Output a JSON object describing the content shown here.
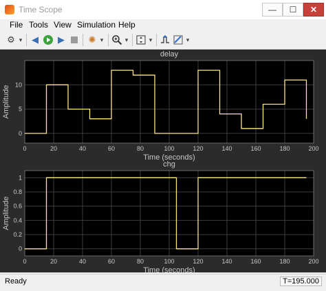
{
  "window": {
    "title": "Time Scope",
    "minimize_glyph": "—",
    "maximize_glyph": "☐",
    "close_glyph": "✕"
  },
  "menu": [
    "File",
    "Tools",
    "View",
    "Simulation",
    "Help"
  ],
  "toolbar": {
    "icons": [
      "gear-icon",
      "step-back-icon",
      "run-icon",
      "step-forward-icon",
      "stop-icon",
      "highlight-icon",
      "zoom-icon",
      "autoscale-icon",
      "triggers-icon",
      "cursor-measurement-icon"
    ]
  },
  "status": {
    "text": "Ready",
    "time": "T=195.000"
  },
  "colors": {
    "plot_bg": "#000000",
    "figure_bg": "#2b2b2b",
    "trace": "#ffe680",
    "grid": "#3c3c3c",
    "axis_text": "#c8c8c8"
  },
  "chart_data": [
    {
      "type": "line",
      "title": "delay",
      "xlabel": "Time (seconds)",
      "ylabel": "Amplitude",
      "xlim": [
        0,
        200
      ],
      "ylim": [
        -2,
        15
      ],
      "xticks": [
        0,
        20,
        40,
        60,
        80,
        100,
        120,
        140,
        160,
        180,
        200
      ],
      "yticks": [
        0,
        5,
        10
      ],
      "step": true,
      "grid": true,
      "x": [
        0,
        15,
        30,
        45,
        60,
        75,
        90,
        105,
        120,
        135,
        150,
        165,
        180,
        195
      ],
      "y": [
        0,
        10,
        5,
        3,
        13,
        12,
        0,
        0,
        13,
        4,
        1,
        6,
        11,
        3
      ]
    },
    {
      "type": "line",
      "title": "chg",
      "xlabel": "Time (seconds)",
      "ylabel": "Amplitude",
      "xlim": [
        0,
        200
      ],
      "ylim": [
        -0.1,
        1.1
      ],
      "xticks": [
        0,
        20,
        40,
        60,
        80,
        100,
        120,
        140,
        160,
        180,
        200
      ],
      "yticks": [
        0,
        0.2,
        0.4,
        0.6,
        0.8,
        1
      ],
      "step": true,
      "grid": true,
      "x": [
        0,
        15,
        105,
        120,
        195
      ],
      "y": [
        0,
        1,
        0,
        1,
        1
      ]
    }
  ]
}
